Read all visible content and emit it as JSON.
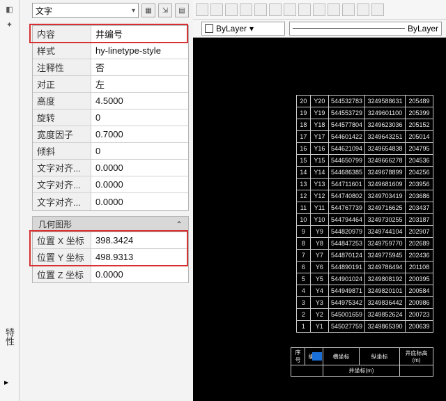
{
  "topCombo": {
    "label": "文字"
  },
  "properties": {
    "rows": [
      {
        "label": "内容",
        "value": "井编号"
      },
      {
        "label": "样式",
        "value": "hy-linetype-style"
      },
      {
        "label": "注释性",
        "value": "否"
      },
      {
        "label": "对正",
        "value": "左"
      },
      {
        "label": "高度",
        "value": "4.5000"
      },
      {
        "label": "旋转",
        "value": "0"
      },
      {
        "label": "宽度因子",
        "value": "0.7000"
      },
      {
        "label": "倾斜",
        "value": "0"
      },
      {
        "label": "文字对齐...",
        "value": "0.0000"
      },
      {
        "label": "文字对齐...",
        "value": "0.0000"
      },
      {
        "label": "文字对齐...",
        "value": "0.0000"
      }
    ]
  },
  "geomHeader": "几何图形",
  "geom": {
    "rows": [
      {
        "label": "位置 X 坐标",
        "value": "398.3424"
      },
      {
        "label": "位置 Y 坐标",
        "value": "498.9313"
      },
      {
        "label": "位置 Z 坐标",
        "value": "0.0000"
      }
    ]
  },
  "vtab": "特性",
  "layer": {
    "label1": "ByLayer",
    "label2": "ByLayer"
  },
  "dataTable": {
    "rows": [
      [
        "20",
        "Y20",
        "544532783",
        "3249588631",
        "205489"
      ],
      [
        "19",
        "Y19",
        "544553729",
        "3249601100",
        "205399"
      ],
      [
        "18",
        "Y18",
        "544577804",
        "3249623036",
        "205152"
      ],
      [
        "17",
        "Y17",
        "544601422",
        "3249643251",
        "205014"
      ],
      [
        "16",
        "Y16",
        "544621094",
        "3249654838",
        "204795"
      ],
      [
        "15",
        "Y15",
        "544650799",
        "3249666278",
        "204536"
      ],
      [
        "14",
        "Y14",
        "544686385",
        "3249678899",
        "204256"
      ],
      [
        "13",
        "Y13",
        "544711601",
        "3249681609",
        "203956"
      ],
      [
        "12",
        "Y12",
        "544740802",
        "3249703419",
        "203686"
      ],
      [
        "11",
        "Y11",
        "544767739",
        "3249716625",
        "203437"
      ],
      [
        "10",
        "Y10",
        "544794464",
        "3249730255",
        "203187"
      ],
      [
        "9",
        "Y9",
        "544820979",
        "3249744104",
        "202907"
      ],
      [
        "8",
        "Y8",
        "544847253",
        "3249759770",
        "202689"
      ],
      [
        "7",
        "Y7",
        "544870124",
        "3249775945",
        "202436"
      ],
      [
        "6",
        "Y6",
        "544890191",
        "3249786494",
        "201108"
      ],
      [
        "5",
        "Y5",
        "544901024",
        "3249808192",
        "200395"
      ],
      [
        "4",
        "Y4",
        "544949871",
        "3249820101",
        "200584"
      ],
      [
        "3",
        "Y3",
        "544975342",
        "3249836442",
        "200986"
      ],
      [
        "2",
        "Y2",
        "545001659",
        "3249852624",
        "200723"
      ],
      [
        "1",
        "Y1",
        "545027759",
        "3249865390",
        "200639"
      ]
    ]
  },
  "footerTable": {
    "r1": [
      "序号",
      "编号",
      "横坐标",
      "纵坐标",
      "井底标高(m)"
    ],
    "r2": "井坐标(m)"
  }
}
